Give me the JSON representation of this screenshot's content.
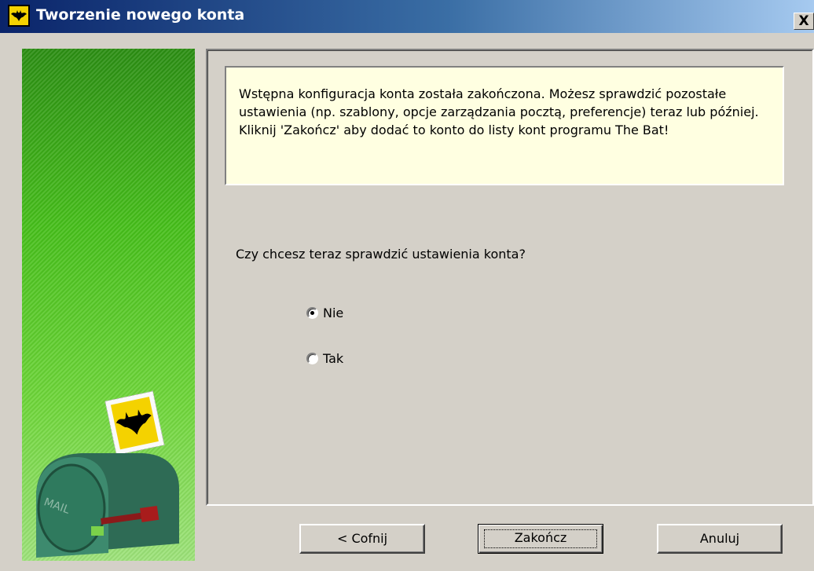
{
  "window": {
    "title": "Tworzenie nowego konta",
    "close_label": "X"
  },
  "banner": {
    "mailbox_label": "MAIL"
  },
  "info": {
    "text": "Wstępna konfiguracja konta została zakończona. Możesz sprawdzić pozostałe ustawienia (np. szablony, opcje zarządzania pocztą, preferencje) teraz lub później. Kliknij 'Zakończ' aby dodać to konto do listy kont programu The Bat!"
  },
  "question": {
    "text": "Czy chcesz teraz sprawdzić ustawienia konta?",
    "options": [
      {
        "label": "Nie",
        "checked": true
      },
      {
        "label": "Tak",
        "checked": false
      }
    ]
  },
  "buttons": {
    "back_prefix": "< ",
    "back_label": "Cofnij",
    "finish_label": "Zakończ",
    "cancel_label": "Anuluj"
  }
}
